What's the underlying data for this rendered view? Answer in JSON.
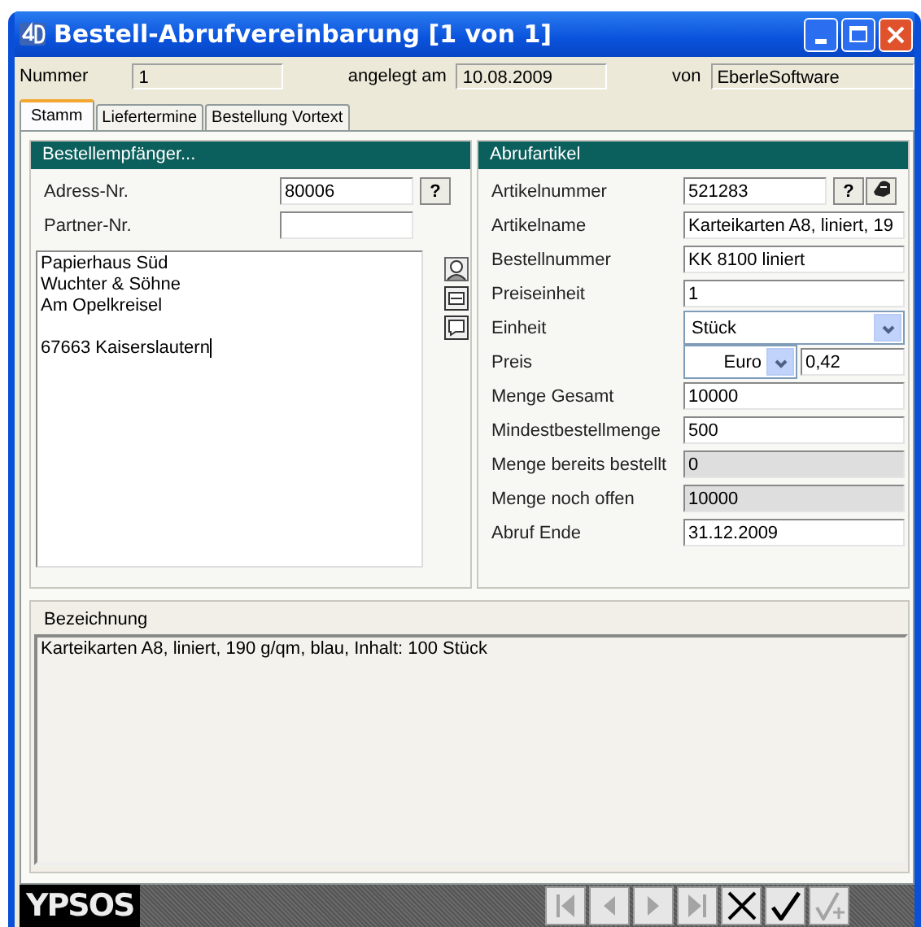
{
  "window": {
    "title": "Bestell-Abrufvereinbarung [1 von 1]"
  },
  "header": [
    {
      "label": "Nummer",
      "value": "1"
    },
    {
      "label": "angelegt am",
      "value": "10.08.2009"
    },
    {
      "label": "von",
      "value": "EberleSoftware"
    }
  ],
  "tabs": [
    {
      "label": "Stamm",
      "selected": true
    },
    {
      "label": "Liefertermine",
      "selected": false
    },
    {
      "label": "Bestellung Vortext",
      "selected": false
    }
  ],
  "recipient": {
    "title": "Bestellempfänger...",
    "address_no": {
      "label": "Adress-Nr.",
      "value": "80006",
      "button": "?"
    },
    "partner_no": {
      "label": "Partner-Nr."
    },
    "address_blocks": [
      [
        "Papierhaus Süd",
        "Wuchter & Söhne",
        "Am Opelkreisel"
      ],
      [
        "67663 Kaiserslautern"
      ]
    ]
  },
  "article": {
    "title": "Abrufartikel",
    "fields": [
      {
        "label": "Artikelnummer",
        "value": "521283",
        "kind": "lookup",
        "button": "?"
      },
      {
        "label": "Artikelname",
        "value": "Karteikarten A8, liniert, 19",
        "kind": "text"
      },
      {
        "label": "Bestellnummer",
        "value": "KK 8100 liniert",
        "kind": "text"
      },
      {
        "label": "Preiseinheit",
        "value": "1",
        "kind": "text"
      },
      {
        "label": "Einheit",
        "value": "Stück",
        "kind": "select"
      },
      {
        "label": "Preis",
        "currency": "Euro",
        "value": "0,42",
        "kind": "price"
      },
      {
        "label": "Menge Gesamt",
        "value": "10000",
        "kind": "text"
      },
      {
        "label": "Mindestbestellmenge",
        "value": "500",
        "kind": "text"
      },
      {
        "label": "Menge bereits bestellt",
        "value": "0",
        "kind": "readonly"
      },
      {
        "label": "Menge noch offen",
        "value": "10000",
        "kind": "readonly"
      },
      {
        "label": "Abruf Ende",
        "value": "31.12.2009",
        "kind": "text"
      }
    ]
  },
  "description": {
    "label": "Bezeichnung",
    "value": "Karteikarten A8, liniert, 190 g/qm, blau, Inhalt: 100 Stück"
  },
  "footer": {
    "logo": "YPSOS",
    "buttons": [
      {
        "kind": "first",
        "disabled": true
      },
      {
        "kind": "prev",
        "disabled": true
      },
      {
        "kind": "next",
        "disabled": true
      },
      {
        "kind": "last",
        "disabled": true
      },
      {
        "kind": "cancel",
        "disabled": false
      },
      {
        "kind": "ok",
        "disabled": false
      },
      {
        "kind": "ok-plus",
        "disabled": true
      }
    ]
  }
}
